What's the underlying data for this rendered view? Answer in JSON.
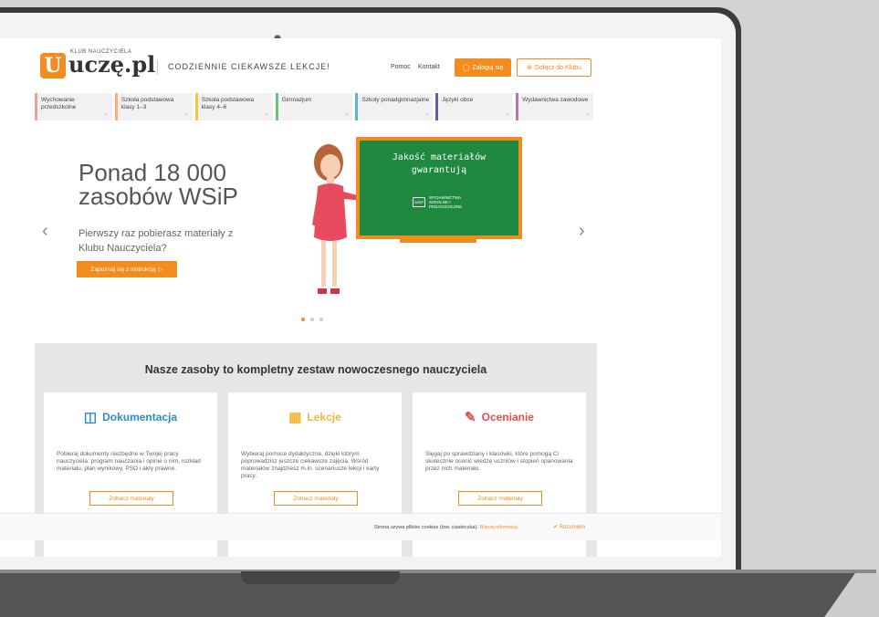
{
  "header": {
    "logo_letter": "U",
    "logo_klub": "KLUB NAUCZYCIELA",
    "logo_name": "uczę.pl",
    "tagline": "CODZIENNIE CIEKAWSZE LEKCJE!",
    "help_link": "Pomoc",
    "contact_link": "Kontakt",
    "login_label": "Zaloguj się",
    "join_label": "Dołącz do Klubu"
  },
  "nav": {
    "items": [
      {
        "label": "Wychowanie przedszkolne",
        "color": "#e8a39b"
      },
      {
        "label": "Szkoła podstawowa klasy 1–3",
        "color": "#f6b17a"
      },
      {
        "label": "Szkoła podstawowa klasy 4–6",
        "color": "#f5c542"
      },
      {
        "label": "Gimnazjum",
        "color": "#6cc17c"
      },
      {
        "label": "Szkoły ponadgimnazjalne",
        "color": "#5ab4d6"
      },
      {
        "label": "Języki obce",
        "color": "#6d5aa8"
      },
      {
        "label": "Wydawnictwa zawodowe",
        "color": "#c074b0"
      }
    ]
  },
  "hero": {
    "title_line1": "Ponad 18 000",
    "title_line2": "zasobów WSiP",
    "subtitle": "Pierwszy raz pobierasz materiały z Klubu Nauczyciela?",
    "button_label": "Zapoznaj się z instrukcją",
    "board_line1": "Jakość materiałów",
    "board_line2": "gwarantują",
    "board_logo_abbr": "WSiP",
    "board_logo_text": "WYDAWNICTWA SZKOLNE I PEDAGOGICZNE"
  },
  "resources": {
    "heading": "Nasze zasoby to kompletny zestaw nowoczesnego nauczyciela",
    "cards": [
      {
        "title": "Dokumentacja",
        "color": "#2a8ec6",
        "text": "Pobieraj dokumenty niezbędne w Twojej pracy nauczyciela: program nauczania i opinie o nim, rozkład materiału, plan wynikowy, PSO i akty prawne.",
        "button": "Zobacz materiały"
      },
      {
        "title": "Lekcje",
        "color": "#f5b63a",
        "text": "Wybieraj pomoce dydaktyczne, dzięki którym poprowadzisz jeszcze ciekawsze zajęcia. Wśród materiałów znajdziesz m.in. scenariusze lekcji i karty pracy.",
        "button": "Zobacz materiały"
      },
      {
        "title": "Ocenianie",
        "color": "#e0504b",
        "text": "Sięgaj po sprawdziany i klasówki, które pomogą Ci skutecznie ocenić wiedzę uczniów i stopień opanowania przez nich materiału.",
        "button": "Zobacz materiały"
      }
    ]
  },
  "cookie": {
    "text": "Strona używa plików cookies (tzw. ciasteczka).",
    "more": "Więcej informacji.",
    "ok": "Rozumiem"
  }
}
